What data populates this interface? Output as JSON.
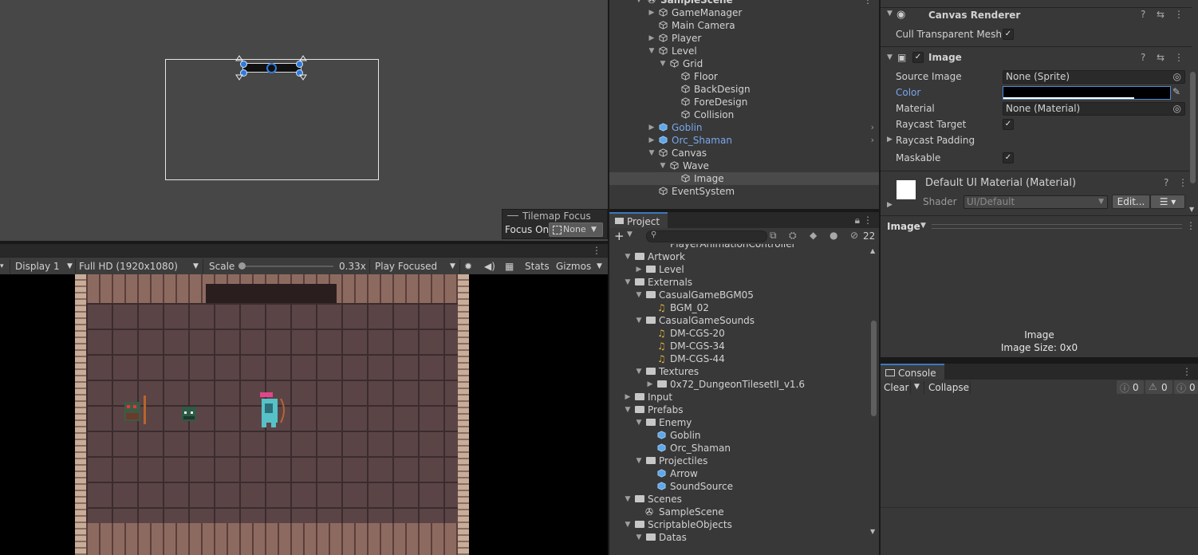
{
  "scene_view": {
    "tilemap_focus": {
      "title": "Tilemap Focus",
      "focus_label": "Focus On",
      "focus_value": "None"
    }
  },
  "game_view": {
    "display": "Display 1",
    "resolution": "Full HD (1920x1080)",
    "scale_label": "Scale",
    "scale_value": "0.33x",
    "play_mode": "Play Focused",
    "stats_label": "Stats",
    "gizmos_label": "Gizmos"
  },
  "hierarchy": {
    "scene_name": "SampleScene",
    "items": [
      {
        "label": "GameManager"
      },
      {
        "label": "Main Camera"
      },
      {
        "label": "Player"
      },
      {
        "label": "Level"
      },
      {
        "label": "Grid"
      },
      {
        "label": "Floor"
      },
      {
        "label": "BackDesign"
      },
      {
        "label": "ForeDesign"
      },
      {
        "label": "Collision"
      },
      {
        "label": "Goblin"
      },
      {
        "label": "Orc_Shaman"
      },
      {
        "label": "Canvas"
      },
      {
        "label": "Wave"
      },
      {
        "label": "Image"
      },
      {
        "label": "EventSystem"
      }
    ]
  },
  "project": {
    "tab_label": "Project",
    "hidden_count": "22",
    "clipped_top": "PlayerAnimationController",
    "items": [
      {
        "label": "Artwork"
      },
      {
        "label": "Level"
      },
      {
        "label": "Externals"
      },
      {
        "label": "CasualGameBGM05"
      },
      {
        "label": "BGM_02"
      },
      {
        "label": "CasualGameSounds"
      },
      {
        "label": "DM-CGS-20"
      },
      {
        "label": "DM-CGS-34"
      },
      {
        "label": "DM-CGS-44"
      },
      {
        "label": "Textures"
      },
      {
        "label": "0x72_DungeonTilesetII_v1.6"
      },
      {
        "label": "Input"
      },
      {
        "label": "Prefabs"
      },
      {
        "label": "Enemy"
      },
      {
        "label": "Goblin"
      },
      {
        "label": "Orc_Shaman"
      },
      {
        "label": "Projectiles"
      },
      {
        "label": "Arrow"
      },
      {
        "label": "SoundSource"
      },
      {
        "label": "Scenes"
      },
      {
        "label": "SampleScene"
      },
      {
        "label": "ScriptableObjects"
      },
      {
        "label": "Datas"
      }
    ]
  },
  "inspector": {
    "canvas_renderer": {
      "title": "Canvas Renderer",
      "cull_label": "Cull Transparent Mesh"
    },
    "image": {
      "title": "Image",
      "source_image_label": "Source Image",
      "source_image_value": "None (Sprite)",
      "color_label": "Color",
      "material_label": "Material",
      "material_value": "None (Material)",
      "raycast_target_label": "Raycast Target",
      "raycast_padding_label": "Raycast Padding",
      "maskable_label": "Maskable"
    },
    "material": {
      "title": "Default UI Material (Material)",
      "shader_label": "Shader",
      "shader_value": "UI/Default",
      "edit_label": "Edit..."
    }
  },
  "preview": {
    "dropdown": "Image",
    "name": "Image",
    "size": "Image Size: 0x0"
  },
  "console": {
    "tab_label": "Console",
    "clear_label": "Clear",
    "collapse_label": "Collapse",
    "info_count": "0",
    "warn_count": "0",
    "error_count": "0"
  }
}
